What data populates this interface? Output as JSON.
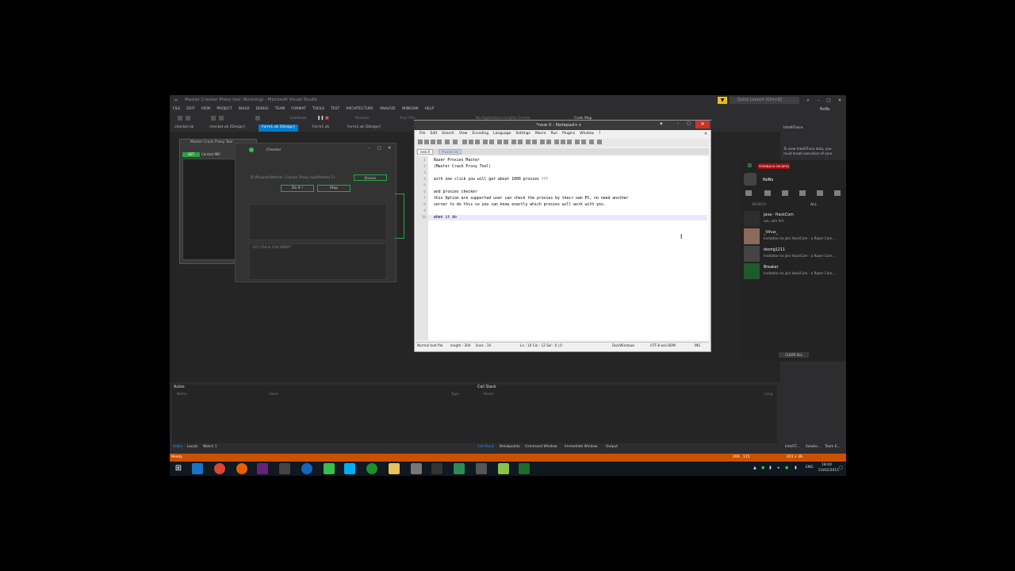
{
  "vs": {
    "title": "Master Cracker Proxy tool (Running) - Microsoft Visual Studio",
    "quick_launch": "Quick Launch (Ctrl+Q)",
    "user": "NoNs",
    "menu": [
      "FILE",
      "EDIT",
      "VIEW",
      "PROJECT",
      "BUILD",
      "DEBUG",
      "TEAM",
      "FORMAT",
      "TOOLS",
      "TEST",
      "ARCHITECTURE",
      "ANALYZE",
      "WINDOW",
      "HELP"
    ],
    "toolbar": {
      "continue": "Continue",
      "release": "Release",
      "cpu": "Any CPU",
      "app_insights": "No Application Insights Events",
      "code_map": "Code Map"
    },
    "doc_tabs": [
      "checker.vb",
      "checker.vb [Design]",
      "Form1.vb [Design]",
      "Form1.vb",
      "Form1.vb [Design]"
    ],
    "status": "Ready",
    "status_right": "206 , 115",
    "status_right2": "201 x 36"
  },
  "designer": {
    "form_title": "Master Crack Proxy Tool",
    "get_btn": "GET",
    "contact_tab": "Contact ME!"
  },
  "checker": {
    "title": "Checker",
    "path": "D:\\Projects\\Master Cracker Proxy tool\\Master Cr",
    "browse": "Browse",
    "doit": "Do It !",
    "stop": "Stop",
    "ip": "107.150.4.119:18697"
  },
  "npp": {
    "title": "*new 0 - Notepad++",
    "menu": [
      "File",
      "Edit",
      "Search",
      "View",
      "Encoding",
      "Language",
      "Settings",
      "Macro",
      "Run",
      "Plugins",
      "Window",
      "?"
    ],
    "tabs": [
      "new 0",
      "Proxies.txt"
    ],
    "lines": [
      "Razer Proxies Master",
      "(Master Crack Proxy Tool)",
      "",
      "with one click you will get about 1000 proxies !!!",
      "",
      "and proxies checker",
      "this Option are supported user can check the proxies by their own PC, no need another",
      "server to do this so you can know exactly which proxies will work with you.",
      "",
      "when it do"
    ],
    "status": {
      "type": "Normal text file",
      "length": "length : 304",
      "lines": "lines : 10",
      "pos": "Ln : 10    Col : 12    Sel : 0 | 0",
      "eol": "Dos\\Windows",
      "enc": "UTF-8 w/o BOM",
      "mode": "INS"
    }
  },
  "intellitrace": {
    "title": "IntelliTrace",
    "msg1": "To view IntelliTrace data, you",
    "msg2": "must break execution of your"
  },
  "comms": {
    "feedback": "FEEDBACK ON BETA",
    "user": "NoNs",
    "search": "SEARCH",
    "filter": "ALL",
    "contacts": [
      {
        "name": "Java - HackCom",
        "status": "um, ulm hill"
      },
      {
        "name": "_Vinus_",
        "status": "Invitation to join HackCom - a Razer Com..."
      },
      {
        "name": "dxong1211",
        "status": "Invitation to join HackCom - a Razer Com..."
      },
      {
        "name": "Breaker",
        "status": "Invitation to join HackCom - a Razer Com..."
      }
    ],
    "clear_all": "CLEAR ALL"
  },
  "autos": {
    "title": "Autos",
    "cols": [
      "Name",
      "Value",
      "Type"
    ],
    "tabs": [
      "Autos",
      "Locals",
      "Watch 1"
    ]
  },
  "callstack": {
    "title": "Call Stack",
    "cols": [
      "Name",
      "Lang"
    ],
    "tabs": [
      "Call Stack",
      "Breakpoints",
      "Command Window",
      "Immediate Window",
      "Output"
    ]
  },
  "right_tabs": [
    "IntelliT...",
    "Solutio...",
    "Team E..."
  ],
  "taskbar": {
    "lang": "ENG",
    "time": "18:04",
    "date": "23/02/2015"
  }
}
